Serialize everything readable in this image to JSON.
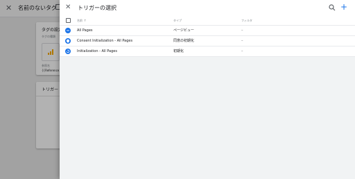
{
  "background": {
    "title": "名前のないタグ",
    "card1": {
      "title": "タグの設定",
      "subtitle": "タグの種類",
      "ref_label": "参照名",
      "ref_value": "{{Reference}}"
    },
    "card2": {
      "title": "トリガー"
    }
  },
  "panel": {
    "title": "トリガーの選択",
    "columns": {
      "name": "名前",
      "sort_indicator": "↑",
      "type": "タイプ",
      "filter": "フィルタ"
    },
    "rows": [
      {
        "name": "All Pages",
        "type": "ページビュー",
        "filter": "–",
        "icon": "pageview-icon",
        "color": "#1a73e8"
      },
      {
        "name": "Consent Initialization - All Pages",
        "type": "同意の初期化",
        "filter": "–",
        "icon": "consent-init-icon",
        "color": "#1a73e8"
      },
      {
        "name": "Initialization - All Pages",
        "type": "初期化",
        "filter": "–",
        "icon": "initialization-icon",
        "color": "#1a73e8"
      }
    ]
  },
  "colors": {
    "accent": "#1a73e8",
    "panel_bg": "#f1f3f4"
  }
}
